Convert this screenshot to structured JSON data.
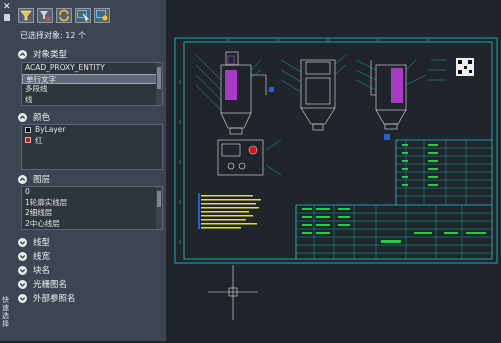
{
  "palette": {
    "title": "快速选择",
    "selection_count_text": "已选择对象: 12 个",
    "toolbar": [
      {
        "name": "filter-icon"
      },
      {
        "name": "filter-remove-icon"
      },
      {
        "name": "refresh-icon"
      },
      {
        "name": "select-objects-icon"
      },
      {
        "name": "settings-icon"
      }
    ],
    "sections": {
      "object_type": {
        "label": "对象类型",
        "items": [
          "ACAD_PROXY_ENTITY",
          "单行文字",
          "多段线",
          "线"
        ],
        "selected_index": 1
      },
      "color": {
        "label": "颜色",
        "items": [
          {
            "label": "ByLayer",
            "swatch": "#000000"
          },
          {
            "label": "红",
            "swatch": "#e01010"
          }
        ]
      },
      "layer": {
        "label": "图层",
        "items": [
          "0",
          "1轮廓实线层",
          "2细线层",
          "2中心线层"
        ]
      },
      "linetype": {
        "label": "线型"
      },
      "lineweight": {
        "label": "线宽"
      },
      "block_name": {
        "label": "块名"
      },
      "raster_name": {
        "label": "光栅图名"
      },
      "xref_name": {
        "label": "外部参照名"
      }
    }
  },
  "colors": {
    "panel_bg": "#3b4652",
    "canvas_bg": "#1f252b",
    "frame_line": "#1ec8c8",
    "highlight_purple": "#c040e0",
    "title_block_green": "#20d040",
    "note_text_yellow": "#e0e030"
  }
}
